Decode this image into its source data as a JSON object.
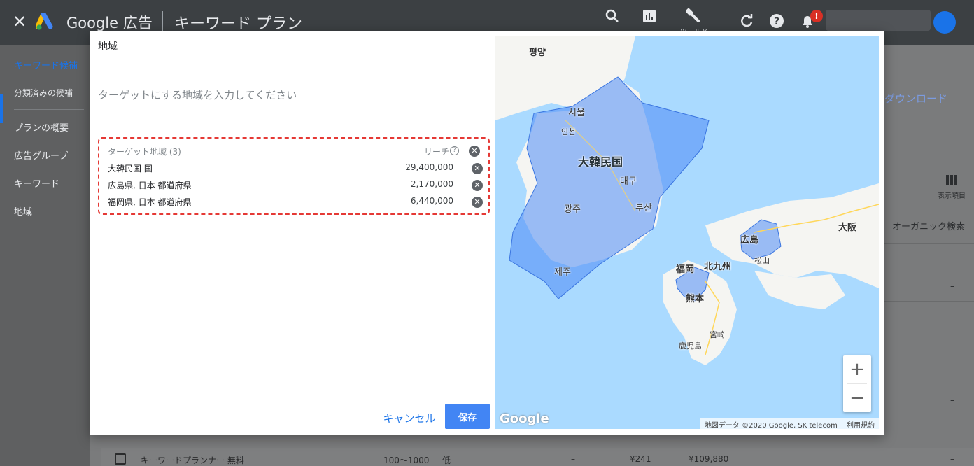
{
  "appbar": {
    "brand": "Google 広告",
    "page_title": "キーワード プラン",
    "tools": [
      {
        "label": "ツールと",
        "icon": "wrench-icon"
      }
    ],
    "notification_badge": "!"
  },
  "leftnav": {
    "items": [
      {
        "label": "キーワード候補",
        "active": true
      },
      {
        "label": "分類済みの候補"
      },
      {
        "label": "プランの概要"
      },
      {
        "label": "広告グループ"
      },
      {
        "label": "キーワード"
      },
      {
        "label": "地域"
      }
    ]
  },
  "background": {
    "download": "ダウンロード",
    "columns_label": "表示項目",
    "organic_header": "オーガニック検索",
    "dash": "–",
    "row": {
      "keyword": "キーワードプランナー 無料",
      "volume": "100〜1000",
      "competition": "低",
      "dash": "–",
      "bid": "¥241",
      "cost": "¥109,880"
    }
  },
  "dialog": {
    "title": "地域",
    "search_placeholder": "ターゲットにする地域を入力してください",
    "targets_header": "ターゲット地域 (3)",
    "reach_label": "リーチ",
    "targets": [
      {
        "name": "大韓民国 国",
        "reach": "29,400,000"
      },
      {
        "name": "広島県, 日本 都道府県",
        "reach": "2,170,000"
      },
      {
        "name": "福岡県, 日本 都道府県",
        "reach": "6,440,000"
      }
    ],
    "cancel_label": "キャンセル",
    "save_label": "保存"
  },
  "map": {
    "labels": {
      "pyongyang": "평양",
      "seoul": "서울",
      "incheon": "인천",
      "korea": "大韓民国",
      "daegu": "대구",
      "gwangju": "광주",
      "busan": "부산",
      "jeju": "제주",
      "hiroshima": "広島",
      "matsuyama": "松山",
      "osaka": "大阪",
      "fukuoka": "福岡",
      "kitakyushu": "北九州",
      "kumamoto": "熊本",
      "miyazaki": "宮崎",
      "kagoshima": "鹿児島"
    },
    "zoom_in": "+",
    "zoom_out": "−",
    "google_mark": "Google",
    "attribution": "地図データ ©2020 Google, SK telecom",
    "terms": "利用規約",
    "colors": {
      "water": "#aadaff",
      "land": "#f5f5f2",
      "highlight": "#4c8bf5"
    }
  }
}
